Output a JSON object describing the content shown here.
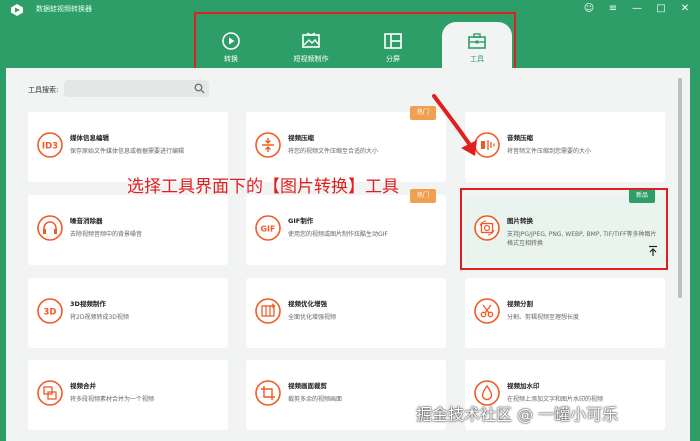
{
  "window": {
    "title": "数据蛙视频转换器",
    "controls": [
      "☺",
      "≡",
      "—",
      "□",
      "✕"
    ]
  },
  "tabs": [
    {
      "label": "转换",
      "icon": "convert-icon"
    },
    {
      "label": "短视频制作",
      "icon": "image-frame-icon"
    },
    {
      "label": "分屏",
      "icon": "split-screen-icon"
    },
    {
      "label": "工具",
      "icon": "toolbox-icon"
    }
  ],
  "active_tab": "工具",
  "search": {
    "label": "工具搜索:",
    "placeholder": ""
  },
  "cards": [
    {
      "title": "媒体信息编辑",
      "desc": "保存原始文件媒体信息或根据需要进行编辑",
      "icon_text": "ID3",
      "badge": ""
    },
    {
      "title": "视频压缩",
      "desc": "将您的视频文件压缩至合适的大小",
      "icon_text": "",
      "badge": "热门"
    },
    {
      "title": "音频压缩",
      "desc": "将音频文件压缩到您需要的大小",
      "icon_text": "",
      "badge": ""
    },
    {
      "title": "噪音消除器",
      "desc": "去除视频音频中的背景噪音",
      "icon_text": "",
      "badge": ""
    },
    {
      "title": "GIF制作",
      "desc": "使用您的视频或图片制作炫酷生动GIF",
      "icon_text": "GIF",
      "badge": "热门"
    },
    {
      "title": "图片转换",
      "desc": "支持JPG/JPEG, PNG, WEBP, BMP, TIF/TIFF等多种图片格式互相转换",
      "icon_text": "",
      "badge": "新品"
    },
    {
      "title": "3D视频制作",
      "desc": "将2D视频转成3D视频",
      "icon_text": "3D",
      "badge": ""
    },
    {
      "title": "视频优化增强",
      "desc": "全面优化增强视频",
      "icon_text": "",
      "badge": ""
    },
    {
      "title": "视频分割",
      "desc": "分割、剪辑视频至理想长度",
      "icon_text": "",
      "badge": ""
    },
    {
      "title": "视频合并",
      "desc": "将多段视频素材合并为一个视频",
      "icon_text": "",
      "badge": ""
    },
    {
      "title": "视频画面裁剪",
      "desc": "裁剪多余的视频画面",
      "icon_text": "",
      "badge": ""
    },
    {
      "title": "视频加水印",
      "desc": "在视频上添加文字和图片水印的视频",
      "icon_text": "",
      "badge": ""
    }
  ],
  "annotation": "选择工具界面下的【图片转换】工具",
  "watermark": "掘金技术社区 @ 一罐小可乐",
  "colors": {
    "brand": "#2e9e68",
    "accent": "#f15a24",
    "highlight": "#e02020",
    "badge_hot": "#f0a050"
  }
}
